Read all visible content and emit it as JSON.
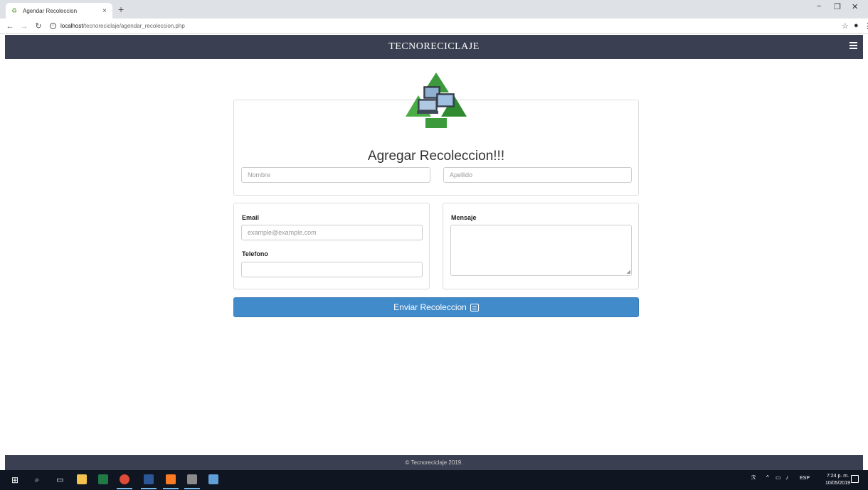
{
  "browser": {
    "tab_title": "Agendar Recoleccion",
    "tab_close": "×",
    "new_tab": "+",
    "url_host": "localhost",
    "url_path": "/tecnoreciclaje/agendar_recoleccion.php",
    "minimize": "−",
    "restore": "❐",
    "close": "✕"
  },
  "header": {
    "brand": "TECNORECICLAJE"
  },
  "form": {
    "title": "Agregar Recoleccion!!!",
    "nombre_placeholder": "Nombre",
    "apellido_placeholder": "Apellido",
    "email_label": "Email",
    "email_placeholder": "example@example.com",
    "telefono_label": "Telefono",
    "mensaje_label": "Mensaje",
    "submit_label": "Enviar Recoleccion"
  },
  "footer": {
    "copyright": "© Tecnoreciclaje 2019."
  },
  "taskbar": {
    "lang": "ESP",
    "time": "7:24 p. m.",
    "date": "10/05/2019"
  },
  "colors": {
    "header_bg": "#3a3f51",
    "button_bg": "#428bca",
    "recycle_green": "#3c9a3c"
  }
}
